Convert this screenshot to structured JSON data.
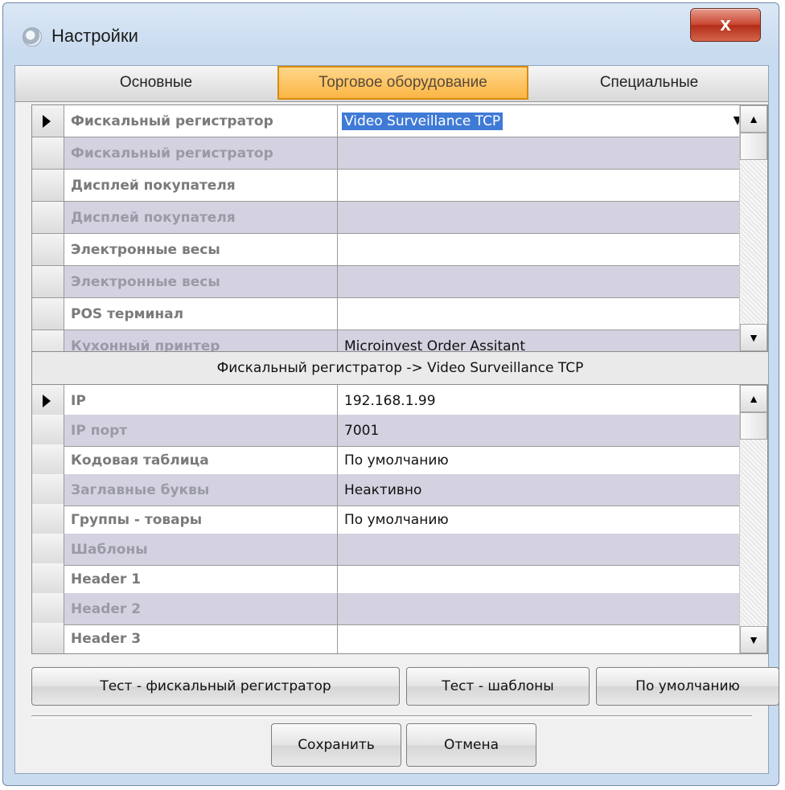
{
  "window": {
    "title": "Настройки",
    "close_label": "x"
  },
  "tabs": [
    {
      "label": "Основные"
    },
    {
      "label": "Торговое оборудование"
    },
    {
      "label": "Специальные"
    }
  ],
  "devices": [
    {
      "name": "Фискальный регистратор",
      "value": "Video Surveillance TCP"
    },
    {
      "name": "Фискальный регистратор",
      "value": ""
    },
    {
      "name": "Дисплей покупателя",
      "value": ""
    },
    {
      "name": "Дисплей покупателя",
      "value": ""
    },
    {
      "name": "Электронные весы",
      "value": ""
    },
    {
      "name": "Электронные весы",
      "value": ""
    },
    {
      "name": "POS терминал",
      "value": ""
    },
    {
      "name": "Кухонный принтер",
      "value": "Microinvest Order Assitant"
    }
  ],
  "section_caption": "Фискальный регистратор -> Video Surveillance TCP",
  "properties": [
    {
      "name": "IP",
      "value": "192.168.1.99"
    },
    {
      "name": "IP порт",
      "value": "7001"
    },
    {
      "name": "Кодовая таблица",
      "value": "По умолчанию"
    },
    {
      "name": "Заглавные буквы",
      "value": "Неактивно"
    },
    {
      "name": "Группы - товары",
      "value": "По умолчанию"
    },
    {
      "name": "Шаблоны",
      "value": ""
    },
    {
      "name": "Header 1",
      "value": ""
    },
    {
      "name": "Header 2",
      "value": ""
    },
    {
      "name": "Header 3",
      "value": ""
    }
  ],
  "buttons": {
    "test_fiscal": "Тест - фискальный регистратор",
    "test_templates": "Тест - шаблоны",
    "defaults": "По умолчанию",
    "save": "Сохранить",
    "cancel": "Отмена"
  },
  "colors": {
    "active_tab": "#fbb645",
    "selection": "#3f7ad6",
    "alt_row": "#d4d2e0"
  }
}
